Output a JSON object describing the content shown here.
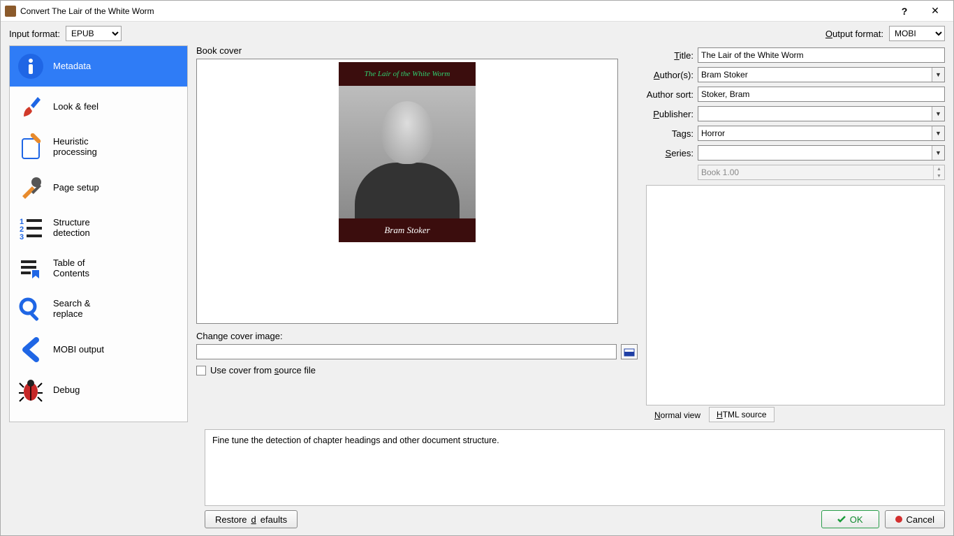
{
  "window": {
    "title": "Convert The Lair of the White Worm"
  },
  "format": {
    "input_label": "Input format:",
    "input_value": "EPUB",
    "output_label_pre": "O",
    "output_label_post": "utput format:",
    "output_value": "MOBI"
  },
  "sidebar": {
    "items": [
      {
        "label": "Metadata"
      },
      {
        "label": "Look & feel"
      },
      {
        "label": "Heuristic\nprocessing"
      },
      {
        "label": "Page setup"
      },
      {
        "label": "Structure\ndetection"
      },
      {
        "label": "Table of\nContents"
      },
      {
        "label": "Search &\nreplace"
      },
      {
        "label": "MOBI output"
      },
      {
        "label": "Debug"
      }
    ]
  },
  "center": {
    "cover_label": "Book cover",
    "cover_title": "The Lair of the White Worm",
    "cover_author": "Bram Stoker",
    "change_label": "Change cover image:",
    "change_value": "",
    "use_source_pre": "Use cover from ",
    "use_source_u": "s",
    "use_source_post": "ource file"
  },
  "right": {
    "title_label_pre": "T",
    "title_label_post": "itle:",
    "title_value": "The Lair of the White Worm",
    "author_label_pre": "A",
    "author_label_post": "uthor(s):",
    "author_value": "Bram Stoker",
    "author_sort_label": "Author sort:",
    "author_sort_value": "Stoker, Bram",
    "publisher_label_pre": "P",
    "publisher_label_post": "ublisher:",
    "publisher_value": "",
    "tags_label_pre": "Ta",
    "tags_label_u": "g",
    "tags_label_post": "s:",
    "tags_value": "Horror",
    "series_label_pre": "S",
    "series_label_post": "eries:",
    "series_value": "",
    "book_number": "Book 1.00",
    "tab_normal_pre": "N",
    "tab_normal_post": "ormal view",
    "tab_html_pre": "H",
    "tab_html_post": "TML source"
  },
  "description": "Fine tune the detection of chapter headings and other document structure.",
  "footer": {
    "restore_pre": "Restore ",
    "restore_u": "d",
    "restore_post": "efaults",
    "ok": "OK",
    "cancel": "Cancel"
  }
}
